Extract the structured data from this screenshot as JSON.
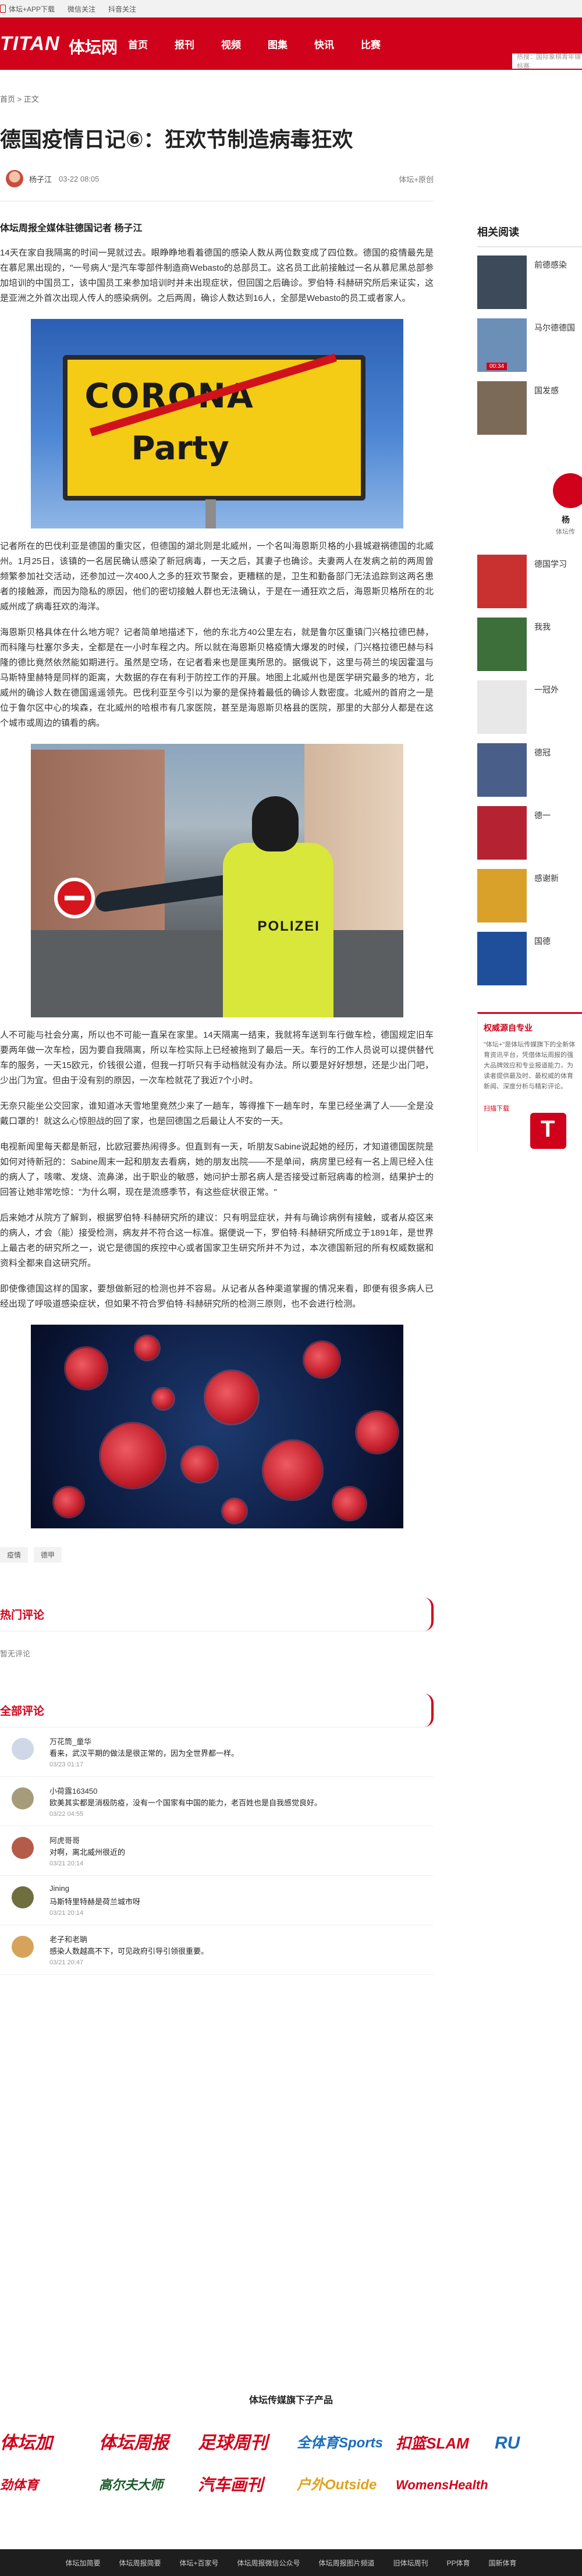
{
  "topbar": {
    "app_download": "体坛+APP下载",
    "weibo": "微信关注",
    "douyin": "抖音关注"
  },
  "nav": {
    "logo_en": "TITAN",
    "logo_cn": "体坛网",
    "items": [
      "首页",
      "报刊",
      "视频",
      "图集",
      "快讯",
      "比赛"
    ],
    "search_placeholder": "热搜：国际象棋青年锦标赛"
  },
  "breadcrumb": "首页 > 正文",
  "article": {
    "title": "德国疫情日记⑥：狂欢节制造病毒狂欢",
    "author": "杨子江",
    "date": "03-22 08:05",
    "follow_label": "体坛+原创",
    "lead": "体坛周报全媒体驻德国记者 杨子江",
    "paragraphs": [
      "14天在家自我隔离的时间一晃就过去。眼睁睁地看着德国的感染人数从两位数变成了四位数。德国的疫情最先是在慕尼黑出现的，\"一号病人\"是汽车零部件制造商Webasto的总部员工。这名员工此前接触过一名从慕尼黑总部参加培训的中国员工，该中国员工来参加培训时并未出现症状，但回国之后确诊。罗伯特·科赫研究所后来证实，这是亚洲之外首次出现人传人的感染病例。之后两周，确诊人数达到16人，全部是Webasto的员工或者家人。",
      "记者所在的巴伐利亚是德国的重灾区，但德国的湖北则是北威州，一个名叫海恩斯贝格的小县城避祸德国的北威州。1月25日，该镇的一名居民确认感染了新冠病毒，一天之后，其妻子也确诊。夫妻两人在发病之前的两周曾频繁参加社交活动，还参加过一次400人之多的狂欢节聚会，更糟糕的是，卫生和勤备部门无法追踪到这两名患者的接触源，而因为隐私的原因，他们的密切接触人群也无法确认，于是在一通狂欢之后，海恩斯贝格所在的北威州成了病毒狂欢的海洋。",
      "海恩斯贝格具体在什么地方呢？记者简单地描述下，他的东北方40公里左右，就是鲁尔区重镇门兴格拉德巴赫，而科隆与杜塞尔多夫，全都是在一小时车程之内。所以就在海恩斯贝格疫情大爆发的时候，门兴格拉德巴赫与科隆的德比竟然依然能如期进行。虽然是空场，在记者看来也是匪夷所思的。据俄说下，这里与荷兰的埃因霍温与马斯特里赫特是同样的距离，大数据的存在有利于防控工作的开展。地图上北威州也是医学研究最多的地方，北威州的确诊人数在德国遥遥领先。巴伐利亚至今引以为豪的是保持着最低的确诊人数密度。北威州的首府之一是位于鲁尔区中心的埃森，在北威州的哈根市有几家医院，甚至是海恩斯贝格县的医院，那里的大部分人都是在这个城市或周边的镇看的病。",
      "人不可能与社会分离，所以也不可能一直呆在家里。14天隔离一结束，我就将车送到车行做车检，德国规定旧车要两年做一次车检，因为要自我隔离，所以车检实际上已经被拖到了最后一天。车行的工作人员说可以提供替代车的服务，一天15欧元，价钱很公道，但我一打听只有手动档就没有办法。所以要是好好想想，还是少出门吧，少出门为宜。但由于没有别的原因，一次车检就花了我近7个小时。",
      "无奈只能坐公交回家，谁知道冰天雪地里竟然少来了一趟车，等得推下一趟车时，车里已经坐满了人——全是没戴口罩的！就这么心惊胆战的回了家，也是回德国之后最让人不安的一天。",
      "电视新闻里每天都是新冠，比欧冠要热闹得多。但直到有一天，听朋友Sabine说起她的经历，才知道德国医院是如何对待新冠的：Sabine周末一起和朋友去看病，她的朋友出院——不是单间，病房里已经有一名上周已经入住的病人了，咳嗽、发烧、流鼻涕，出于职业的敏感，她问护士那名病人是否接受过新冠病毒的检测，结果护士的回答让她非常吃惊：\"为什么啊，现在是流感季节，有这些症状很正常。\"",
      "后来她才从院方了解到，根据罗伯特·科赫研究所的建议：只有明显症状，并有与确诊病例有接触，或者从疫区来的病人，才会（能）接受检测，病友并不符合这一标准。据便说一下，罗伯特·科赫研究所成立于1891年，是世界上最古老的研究所之一，说它是德国的疾控中心或者国家卫生研究所并不为过，本次德国新冠的所有权威数据和资料全都来自这研究所。",
      "即使像德国这样的国家，要想做新冠的检测也并不容易。从记者从各种渠道掌握的情况来看，即便有很多病人已经出现了呼吸道感染症状，但如果不符合罗伯特·科赫研究所的检测三原则，也不会进行检测。"
    ],
    "sign_text1": "CORONA",
    "sign_text2": "Party",
    "police_text": "POLIZEI",
    "tags": [
      "疫情",
      "德甲"
    ]
  },
  "hot_comments": {
    "title": "热门评论",
    "empty_text": "暂无评论"
  },
  "all_comments": {
    "title": "全部评论",
    "items": [
      {
        "user": "万花筒_童华",
        "text": "看来，武汉平期的做法是很正常的，因为全世界都一样。",
        "time": "03/23 01:17",
        "avatar_color": "#cfd8e6"
      },
      {
        "user": "小荷露163450",
        "text": "欧美其实都是消极防疫，没有一个国家有中国的能力，老百姓也是自我感觉良好。",
        "time": "03/22 04:55",
        "avatar_color": "#a79c7a"
      },
      {
        "user": "阿虎哥哥",
        "text": "对啊，离北威州很近的",
        "time": "03/21 20:14",
        "avatar_color": "#b45b4a"
      },
      {
        "user": "Jining",
        "text": "马斯特里特赫是荷兰城市呀",
        "time": "03/21 20:14",
        "avatar_color": "#6e6e3e"
      },
      {
        "user": "老子和老聃",
        "text": "感染人数越高不下，可见政府引导引领很重要。",
        "time": "03/21 20:47",
        "avatar_color": "#d7a35a"
      }
    ]
  },
  "sidebar": {
    "related_title": "相关阅读",
    "video_badge": "00:34",
    "items": [
      {
        "text": "前德感染",
        "color": "#3c4a5a"
      },
      {
        "text": "马尔德德国",
        "color": "#6c8fb8"
      },
      {
        "text": "国发感",
        "color": "#7b6a58"
      }
    ],
    "author_name": "杨",
    "author_sub": "体坛传",
    "more_items": [
      {
        "text": "德国学习",
        "color": "#c8312f"
      },
      {
        "text": "我我",
        "color": "#3d6f3a"
      },
      {
        "text": "一冠外",
        "color": "#e8e8e8"
      },
      {
        "text": "德冠",
        "color": "#4a5e8a"
      },
      {
        "text": "德一",
        "color": "#b52332"
      },
      {
        "text": "感谢新",
        "color": "#d9a12a"
      },
      {
        "text": "国德",
        "color": "#1f4f9a"
      }
    ],
    "auth": {
      "title": "权威源自专业",
      "desc": "\"体坛+\"是体坛传媒旗下的全新体育资讯平台，凭借体坛周报的强大品牌效应和专业报道能力，为读者提供最及时、最权威的体育新闻、深度分析与精彩评论。",
      "link": "扫描下载"
    }
  },
  "footer": {
    "brands_title": "体坛传媒旗下子产品",
    "brands": [
      {
        "name": "体坛加",
        "color": "#d0021b"
      },
      {
        "name": "体坛周报",
        "color": "#d0021b"
      },
      {
        "name": "足球周刊",
        "color": "#d0021b"
      },
      {
        "name": "全体育Sports",
        "color": "#1a6dbd"
      },
      {
        "name": "扣篮SLAM",
        "color": "#d0021b"
      },
      {
        "name": "RU",
        "color": "#1a6dbd"
      },
      {
        "name": "劲体育",
        "color": "#d0021b"
      },
      {
        "name": "高尔夫大师",
        "color": "#1a5a2a"
      },
      {
        "name": "汽车画刊",
        "color": "#d0021b"
      },
      {
        "name": "户外Outside",
        "color": "#e0a21a"
      },
      {
        "name": "WomensHealth",
        "color": "#d0021b"
      },
      {
        "name": "",
        "color": "#ffffff"
      }
    ],
    "links": [
      "体坛加简要",
      "体坛周报简要",
      "体坛+百家号",
      "体坛周报微信公众号",
      "体坛周报图片频道",
      "旧体坛周刊",
      "PP体育",
      "国新体育"
    ]
  }
}
